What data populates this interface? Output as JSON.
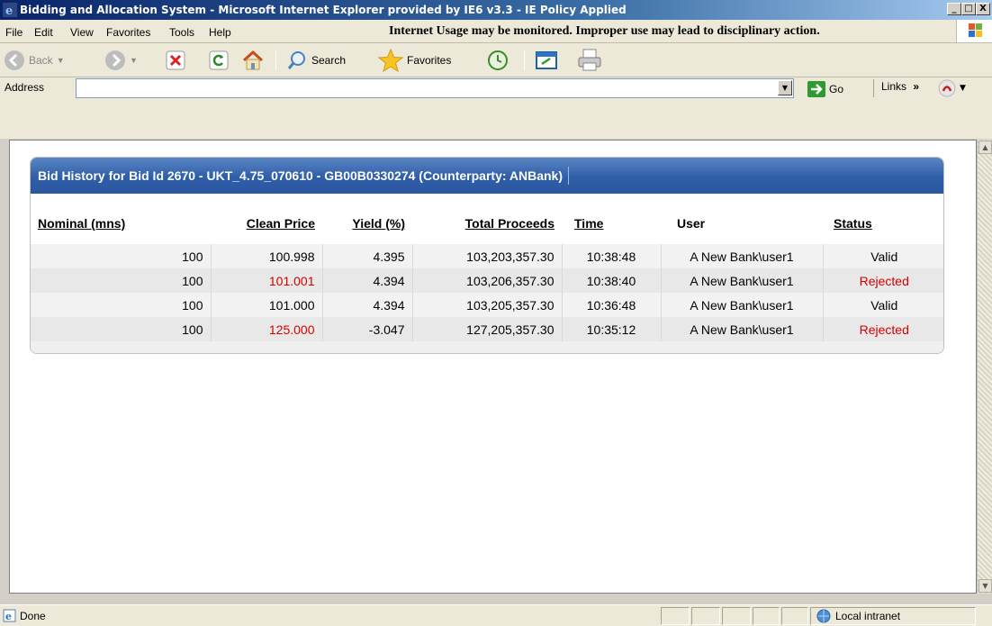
{
  "window": {
    "title": "Bidding and Allocation System - Microsoft Internet Explorer provided by IE6 v3.3 - IE Policy Applied",
    "minimize": "_",
    "maximize": "□",
    "close": "X"
  },
  "menu": {
    "items": [
      "File",
      "Edit",
      "View",
      "Favorites",
      "Tools",
      "Help"
    ],
    "notice": "Internet Usage may be monitored. Improper use may lead to disciplinary action."
  },
  "toolbar": {
    "back_label": "Back",
    "search_label": "Search",
    "favorites_label": "Favorites"
  },
  "address": {
    "label": "Address",
    "go_label": "Go",
    "links_label": "Links"
  },
  "panel": {
    "title": "Bid History for Bid Id 2670 - UKT_4.75_070610 - GB00B0330274 (Counterparty: ANBank)",
    "columns": [
      "Nominal (mns)",
      "Clean Price",
      "Yield (%)",
      "Total Proceeds",
      "Time",
      "User",
      "Status"
    ],
    "rows": [
      {
        "nominal": "100",
        "clean_price": "100.998",
        "yield": "4.395",
        "total_proceeds": "103,203,357.30",
        "time": "10:38:48",
        "user": "A New Bank\\user1",
        "status": "Valid"
      },
      {
        "nominal": "100",
        "clean_price": "101.001",
        "yield": "4.394",
        "total_proceeds": "103,206,357.30",
        "time": "10:38:40",
        "user": "A New Bank\\user1",
        "status": "Rejected"
      },
      {
        "nominal": "100",
        "clean_price": "101.000",
        "yield": "4.394",
        "total_proceeds": "103,205,357.30",
        "time": "10:36:48",
        "user": "A New Bank\\user1",
        "status": "Valid"
      },
      {
        "nominal": "100",
        "clean_price": "125.000",
        "yield": "-3.047",
        "total_proceeds": "127,205,357.30",
        "time": "10:35:12",
        "user": "A New Bank\\user1",
        "status": "Rejected"
      }
    ]
  },
  "statusbar": {
    "text": "Done",
    "zone": "Local intranet"
  },
  "colors": {
    "rejected": "#d60000",
    "header_blue": "#2f5ea8"
  }
}
